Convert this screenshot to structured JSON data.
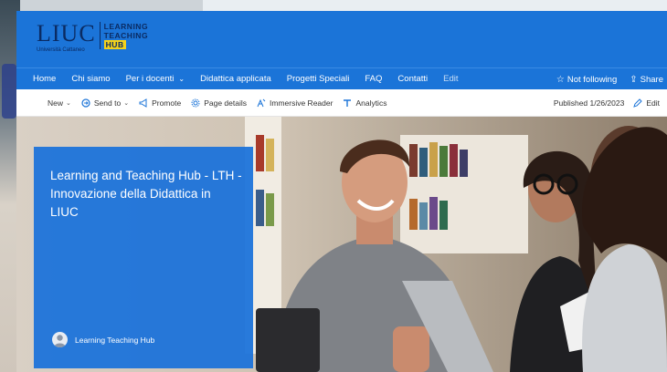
{
  "header": {
    "logo": {
      "liuc": "LIUC",
      "subtitle": "Università Cattaneo",
      "line1": "LEARNING",
      "line2": "TEACHING",
      "hub": "HUB"
    }
  },
  "nav": {
    "items": [
      {
        "label": "Home"
      },
      {
        "label": "Chi siamo"
      },
      {
        "label": "Per i docenti",
        "has_dropdown": true
      },
      {
        "label": "Didattica applicata"
      },
      {
        "label": "Progetti Speciali"
      },
      {
        "label": "FAQ"
      },
      {
        "label": "Contatti"
      },
      {
        "label": "Edit"
      }
    ],
    "follow_label": "Not following",
    "share_label": "Share"
  },
  "command_bar": {
    "new_label": "New",
    "send_to_label": "Send to",
    "promote_label": "Promote",
    "page_details_label": "Page details",
    "immersive_reader_label": "Immersive Reader",
    "analytics_label": "Analytics",
    "published_label": "Published 1/26/2023",
    "edit_label": "Edit"
  },
  "hero": {
    "title": "Learning and Teaching Hub - LTH - Innovazione della Didattica in LIUC",
    "author": "Learning Teaching Hub"
  },
  "colors": {
    "brand_blue": "#1b74d8",
    "logo_navy": "#0a2b63",
    "logo_yellow": "#f4d21b",
    "banner_blue": "#1971da"
  }
}
